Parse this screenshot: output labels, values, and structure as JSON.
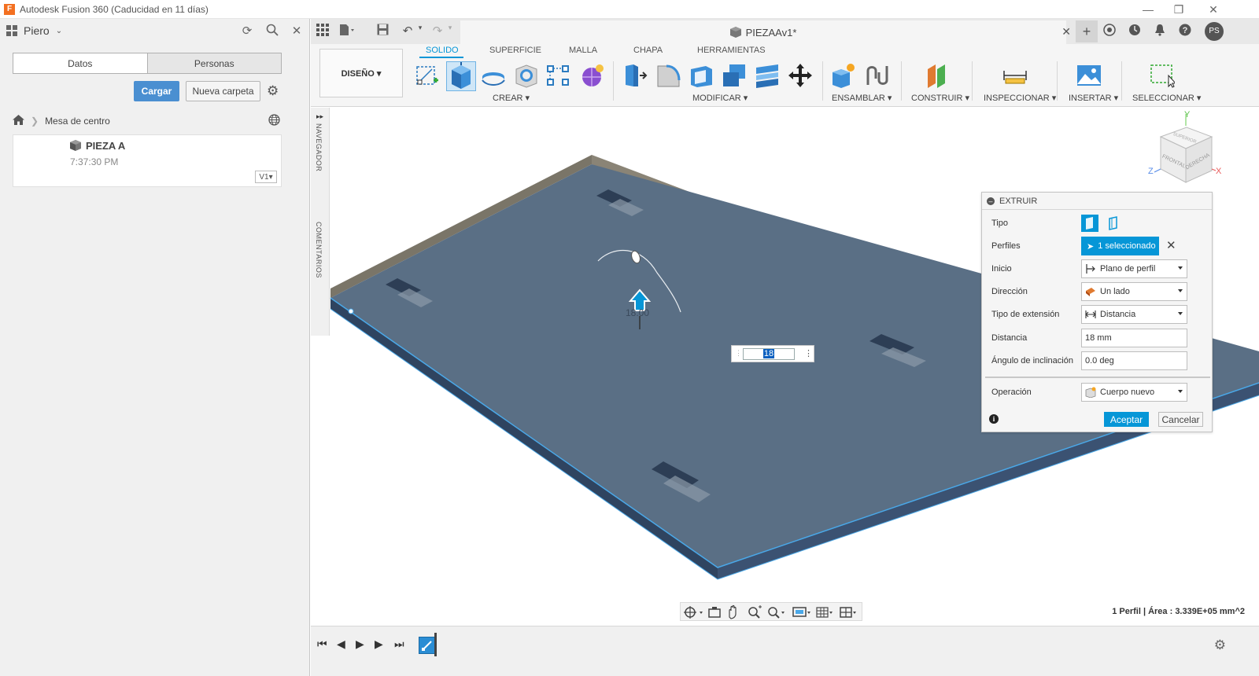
{
  "window": {
    "title": "Autodesk Fusion 360 (Caducidad en 11 días)",
    "app_icon_letter": "F",
    "controls": [
      "—",
      "❐",
      "✕"
    ]
  },
  "data_panel": {
    "user": "Piero",
    "tabs": [
      {
        "label": "Datos",
        "active": true
      },
      {
        "label": "Personas",
        "active": false
      }
    ],
    "upload_label": "Cargar",
    "new_folder_label": "Nueva carpeta",
    "breadcrumb": "Mesa de centro",
    "files": [
      {
        "name": "PIEZA A",
        "time": "7:37:30 PM",
        "version": "V1▾"
      }
    ]
  },
  "appbar": {
    "doc_title": "PIEZAAv1*",
    "user_initials": "PS"
  },
  "ribbon": {
    "workspace": "DISEÑO ▾",
    "tabs": [
      {
        "label": "SOLIDO",
        "active": true
      },
      {
        "label": "SUPERFICIE",
        "active": false
      },
      {
        "label": "MALLA",
        "active": false
      },
      {
        "label": "CHAPA",
        "active": false
      },
      {
        "label": "HERRAMIENTAS",
        "active": false
      }
    ],
    "groups": {
      "create": "CREAR ▾",
      "modify": "MODIFICAR ▾",
      "assemble": "ENSAMBLAR ▾",
      "construct": "CONSTRUIR ▾",
      "inspect": "INSPECCIONAR ▾",
      "insert": "INSERTAR ▾",
      "select": "SELECCIONAR ▾"
    }
  },
  "viewport": {
    "navigator_label": "NAVEGADOR",
    "comments_label": "COMENTARIOS",
    "distance_input": "18",
    "manipulator_label": "18.00",
    "viewcube": {
      "faces": [
        "SUPERIOR",
        "FRONTAL",
        "DERECHA"
      ],
      "axes": [
        "Y",
        "Z",
        "X"
      ]
    },
    "status": "1 Perfil | Área : 3.339E+05 mm^2"
  },
  "extrude": {
    "title": "EXTRUIR",
    "rows": {
      "type": "Tipo",
      "profiles": "Perfiles",
      "profiles_value": "1 seleccionado",
      "start": "Inicio",
      "start_value": "Plano de perfil",
      "direction": "Dirección",
      "direction_value": "Un lado",
      "extent": "Tipo de extensión",
      "extent_value": "Distancia",
      "distance": "Distancia",
      "distance_value": "18 mm",
      "taper": "Ángulo de inclinación",
      "taper_value": "0.0 deg",
      "operation": "Operación",
      "operation_value": "Cuerpo nuevo"
    },
    "ok_label": "Aceptar",
    "cancel_label": "Cancelar"
  },
  "colors": {
    "accent": "#0696d7",
    "body": "#5a6f85",
    "upload": "#4a8fd1"
  }
}
